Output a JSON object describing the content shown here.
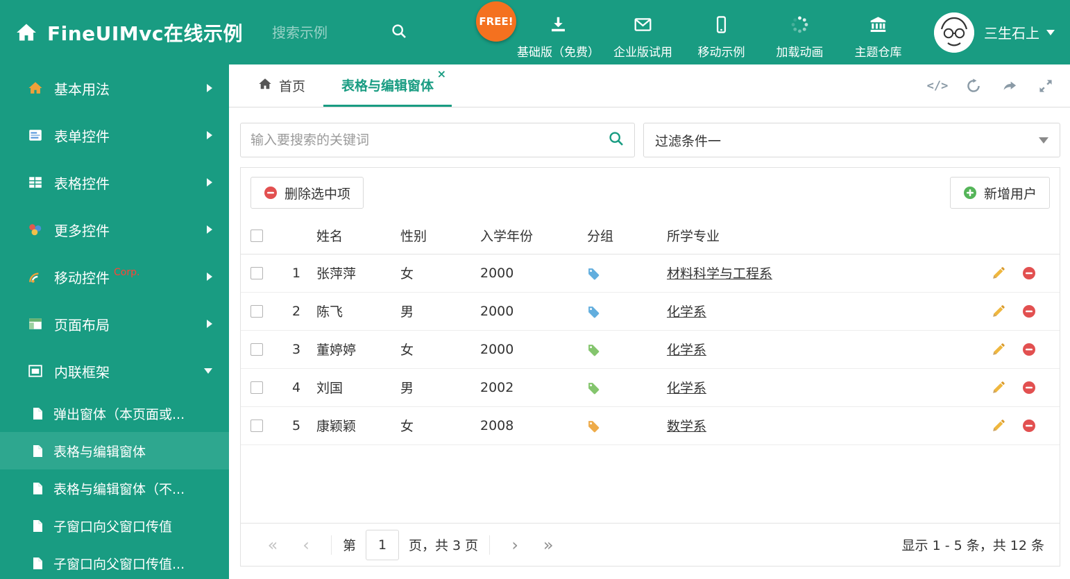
{
  "header": {
    "app_title": "FineUIMvc在线示例",
    "search_placeholder": "搜索示例",
    "free_badge": "FREE!",
    "nav_items": [
      {
        "label": "基础版（免费）",
        "icon": "download-icon"
      },
      {
        "label": "企业版试用",
        "icon": "envelope-icon"
      },
      {
        "label": "移动示例",
        "icon": "mobile-icon"
      },
      {
        "label": "加载动画",
        "icon": "spinner-icon"
      },
      {
        "label": "主题仓库",
        "icon": "bank-icon"
      }
    ],
    "user_name": "三生石上"
  },
  "sidebar": {
    "items": [
      {
        "label": "基本用法",
        "icon": "home-icon"
      },
      {
        "label": "表单控件",
        "icon": "form-icon"
      },
      {
        "label": "表格控件",
        "icon": "table-icon"
      },
      {
        "label": "更多控件",
        "icon": "widgets-icon"
      },
      {
        "label": "移动控件",
        "icon": "mobile-signal-icon",
        "badge": "Corp."
      },
      {
        "label": "页面布局",
        "icon": "layout-icon"
      },
      {
        "label": "内联框架",
        "icon": "frame-icon"
      }
    ],
    "subitems": [
      {
        "label": "弹出窗体（本页面或..."
      },
      {
        "label": "表格与编辑窗体"
      },
      {
        "label": "表格与编辑窗体（不..."
      },
      {
        "label": "子窗口向父窗口传值"
      },
      {
        "label": "子窗口向父窗口传值..."
      }
    ]
  },
  "tabbar": {
    "home_tab": "首页",
    "active_tab": "表格与编辑窗体",
    "close_glyph": "×"
  },
  "filterbar": {
    "search_placeholder": "输入要搜索的关键词",
    "filter_value": "过滤条件一"
  },
  "grid": {
    "delete_button": "删除选中项",
    "add_button": "新增用户",
    "columns": {
      "name": "姓名",
      "gender": "性别",
      "year": "入学年份",
      "group": "分组",
      "major": "所学专业"
    },
    "rows": [
      {
        "num": "1",
        "name": "张萍萍",
        "gender": "女",
        "year": "2000",
        "tag_style": "color:#62aede",
        "major": "材料科学与工程系"
      },
      {
        "num": "2",
        "name": "陈飞",
        "gender": "男",
        "year": "2000",
        "tag_style": "color:#62aede",
        "major": "化学系"
      },
      {
        "num": "3",
        "name": "董婷婷",
        "gender": "女",
        "year": "2000",
        "tag_style": "color:#84c56d",
        "major": "化学系"
      },
      {
        "num": "4",
        "name": "刘国",
        "gender": "男",
        "year": "2002",
        "tag_style": "color:#84c56d",
        "major": "化学系"
      },
      {
        "num": "5",
        "name": "康颖颖",
        "gender": "女",
        "year": "2008",
        "tag_style": "color:#eeab49",
        "major": "数学系"
      }
    ]
  },
  "pager": {
    "first_glyph": "«",
    "prev_glyph": "‹",
    "next_glyph": "›",
    "last_glyph": "»",
    "page_label_prefix": "第",
    "page_input": "1",
    "page_label_suffix": "页，共 3 页",
    "summary": "显示 1 - 5 条，共 12 条"
  },
  "colors": {
    "primary_teal": "#199c82",
    "sidebar_active": "#2ea78f",
    "free_badge_orange": "#f4711f",
    "delete_red": "#e25050",
    "add_green": "#55b559",
    "pencil_gold": "#efb73e",
    "tag_blue": "#62aede",
    "tag_green": "#84c56d",
    "tag_orange": "#eeab49"
  },
  "icons": {
    "home-icon": "house",
    "search-icon": "magnifier",
    "download-icon": "down-arrow-tray",
    "envelope-icon": "mail",
    "mobile-icon": "phone",
    "spinner-icon": "loading-dots",
    "bank-icon": "museum",
    "file-icon": "page",
    "code-icon": "</>",
    "refresh-icon": "circular-arrow",
    "forward-icon": "share-arrow",
    "expand-icon": "diagonal-arrows",
    "tag-icon": "label-tag",
    "edit-icon": "pencil",
    "delete-icon": "red-minus-circle",
    "add-icon": "green-plus-circle",
    "chevron-right-icon": "▶",
    "chevron-down-icon": "▼"
  }
}
